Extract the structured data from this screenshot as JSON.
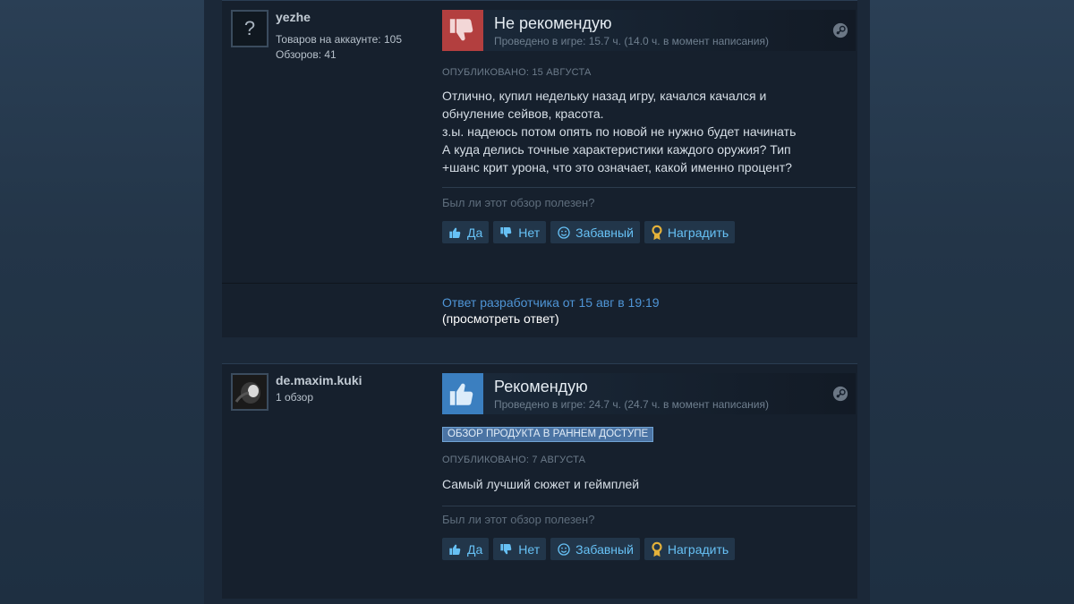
{
  "reviews": [
    {
      "author": "yezhe",
      "stats": [
        "Товаров на аккаунте: 105",
        "Обзоров: 41"
      ],
      "avatar_icon": "question-mark-icon",
      "verdict": "Не рекомендую",
      "verdict_icon": "thumbs-down-icon",
      "hours": "Проведено в игре: 15.7 ч. (14.0 ч. в момент написания)",
      "posted": "ОПУБЛИКОВАНО: 15 АВГУСТА",
      "text_lines": [
        "Отлично, купил недельку назад игру, качался качался и",
        "обнуление сейвов, красота.",
        "з.ы. надеюсь потом опять по новой не нужно будет начинать",
        "А куда делись точные характеристики каждого оружия? Тип",
        "+шанс крит урона, что это означает, какой именно процент?"
      ],
      "helpful_question": "Был ли этот обзор полезен?",
      "dev_response": "Ответ разработчика от 15 авг в 19:19",
      "dev_view": "(просмотреть ответ)"
    },
    {
      "author": "de.maxim.kuki",
      "stats": [
        "1 обзор"
      ],
      "avatar_icon": "profile-photo-icon",
      "verdict": "Рекомендую",
      "verdict_icon": "thumbs-up-icon",
      "hours": "Проведено в игре: 24.7 ч. (24.7 ч. в момент написания)",
      "badge": "ОБЗОР ПРОДУКТА В РАННЕМ ДОСТУПЕ",
      "posted": "ОПУБЛИКОВАНО: 7 АВГУСТА",
      "text_lines": [
        "Самый лучший сюжет и геймплей"
      ],
      "helpful_question": "Был ли этот обзор полезен?"
    }
  ],
  "buttons": {
    "yes": "Да",
    "no": "Нет",
    "funny": "Забавный",
    "award": "Наградить"
  },
  "colors": {
    "negative": "#b33f3f",
    "positive": "#3b7fc0",
    "link": "#67c1f5",
    "award": "#e5b23a"
  }
}
